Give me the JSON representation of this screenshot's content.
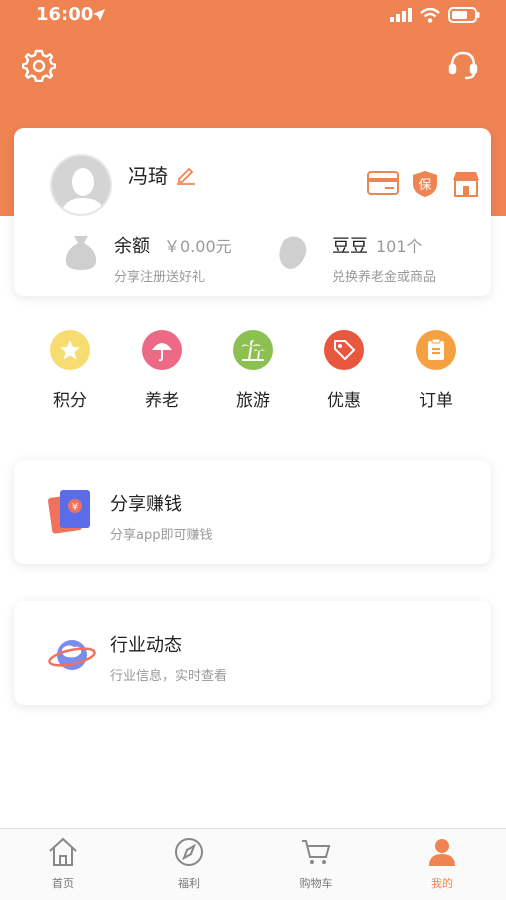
{
  "status_bar": {
    "time": "16:00"
  },
  "profile": {
    "name": "冯琦",
    "balance_label": "余额",
    "balance_value": "￥0.00元",
    "balance_sub": "分享注册送好礼",
    "beans_label": "豆豆",
    "beans_value": "101个",
    "beans_sub": "兑换养老金或商品",
    "card_icon_text_2": "保"
  },
  "menu": [
    {
      "label": "积分",
      "icon": "star-icon",
      "color": "#F5D76E"
    },
    {
      "label": "养老",
      "icon": "umbrella-icon",
      "color": "#EC6A86"
    },
    {
      "label": "旅游",
      "icon": "palm-tree-icon",
      "color": "#8CC152"
    },
    {
      "label": "优惠",
      "icon": "coupon-tag-icon",
      "color": "#E9573F"
    },
    {
      "label": "订单",
      "icon": "order-clipboard-icon",
      "color": "#F5A142"
    }
  ],
  "features": [
    {
      "title": "分享赚钱",
      "sub": "分享app即可赚钱",
      "icon": "red-envelope-icon"
    },
    {
      "title": "行业动态",
      "sub": "行业信息，实时查看",
      "icon": "planet-icon"
    }
  ],
  "tabbar": [
    {
      "label": "首页",
      "icon": "home-icon",
      "active": false
    },
    {
      "label": "福利",
      "icon": "compass-icon",
      "active": false
    },
    {
      "label": "购物车",
      "icon": "cart-icon",
      "active": false
    },
    {
      "label": "我的",
      "icon": "user-icon",
      "active": true
    }
  ],
  "colors": {
    "accent": "#EF8452",
    "muted_text": "#999999"
  }
}
